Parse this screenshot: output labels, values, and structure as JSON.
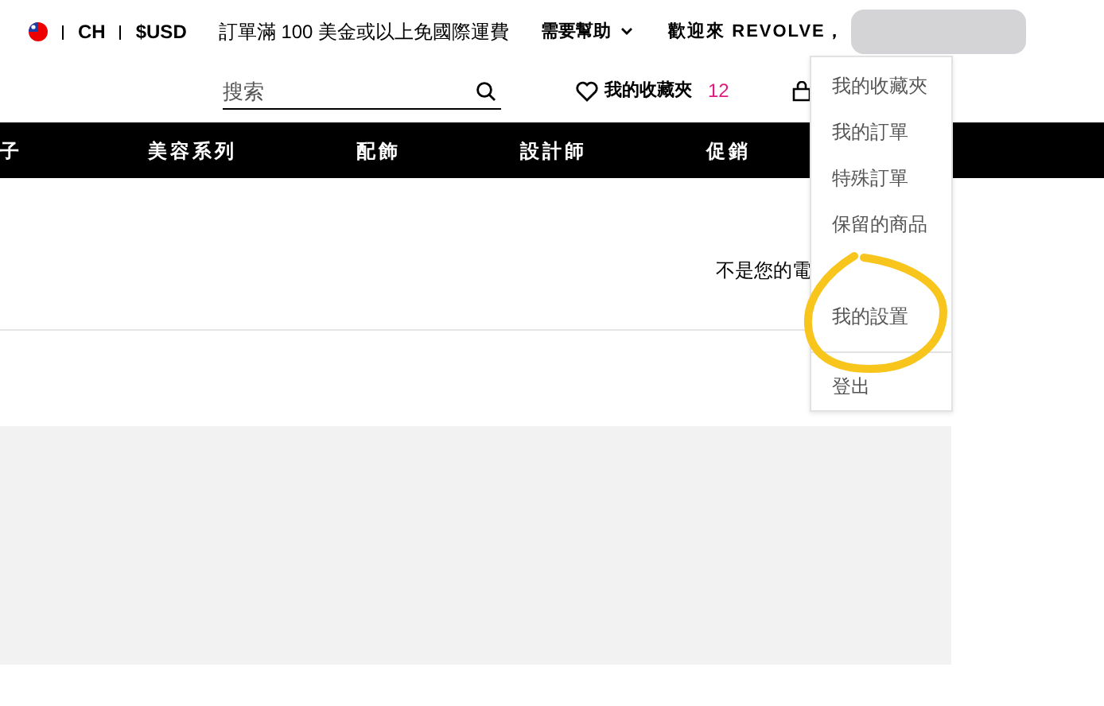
{
  "top_bar": {
    "country": "CH",
    "currency": "$USD",
    "shipping_note": "訂單滿 100 美金或以上免國際運費",
    "help": "需要幫助",
    "welcome": "歡迎來 REVOLVE，"
  },
  "search": {
    "placeholder": "搜索"
  },
  "wishlist": {
    "label": "我的收藏夾",
    "count": "12"
  },
  "nav": [
    "子",
    "美容系列",
    "配飾",
    "設計師",
    "促銷"
  ],
  "notice": "不是您的電",
  "account_menu": {
    "items": [
      "我的收藏夾",
      "我的訂單",
      "特殊訂單",
      "保留的商品"
    ],
    "highlighted_item": "我的設置",
    "logout": "登出"
  }
}
